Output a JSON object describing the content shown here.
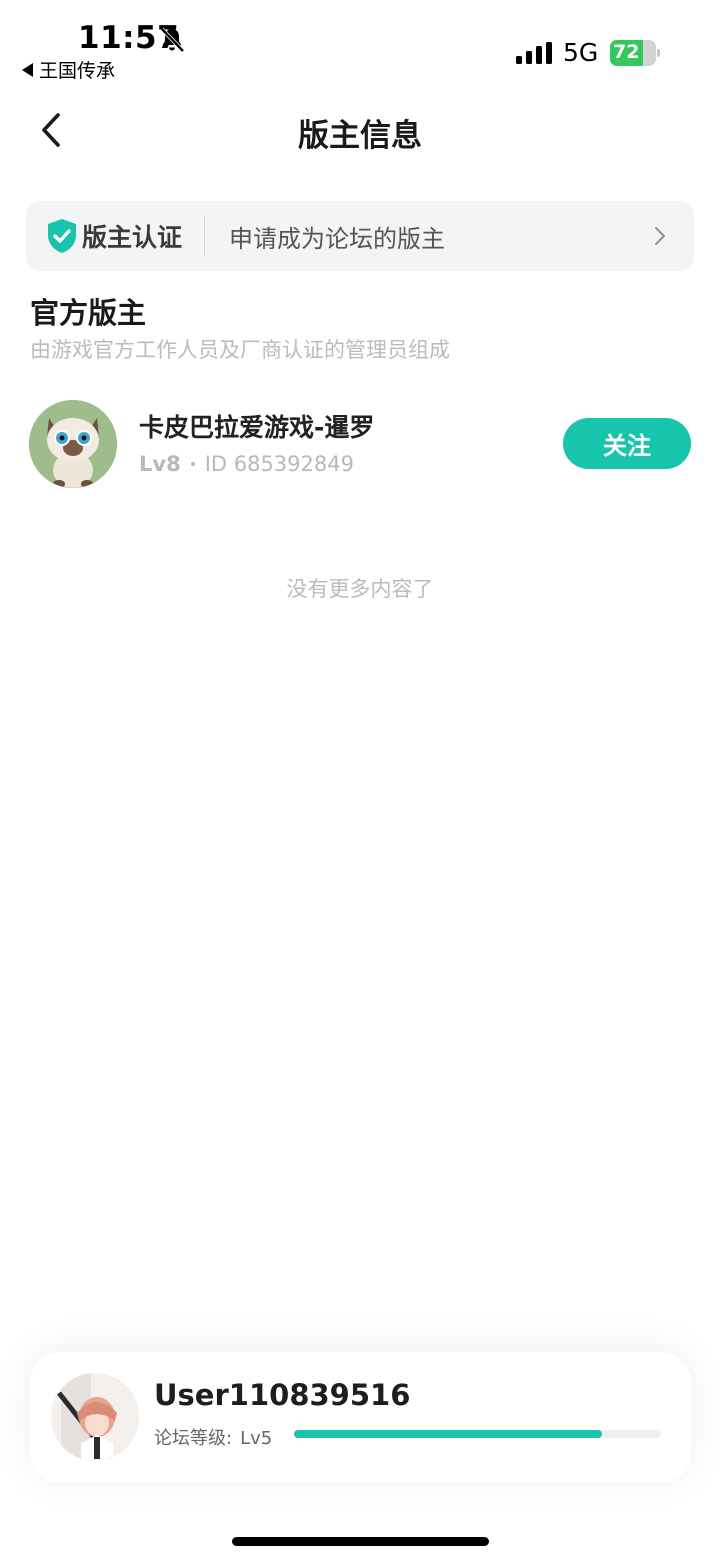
{
  "status_bar": {
    "time": "11:57",
    "back_app": "王国传承",
    "network": "5G",
    "battery_level": "72",
    "battery_fraction": 0.72,
    "battery_color": "#34c759"
  },
  "header": {
    "title": "版主信息",
    "back_icon": "chevron-left-icon"
  },
  "cert_banner": {
    "label": "版主认证",
    "description": "申请成为论坛的版主",
    "icon": "shield-check-icon",
    "accent": "#18c5ac"
  },
  "section": {
    "title": "官方版主",
    "subtitle": "由游戏官方工作人员及厂商认证的管理员组成"
  },
  "moderators": [
    {
      "name": "卡皮巴拉爱游戏-暹罗",
      "level": "Lv8",
      "id_text": "ID 685392849",
      "follow_label": "关注"
    }
  ],
  "list_end_text": "没有更多内容了",
  "user_card": {
    "username": "User110839516",
    "level_label": "论坛等级:",
    "level_value": "Lv5",
    "progress": 0.84
  }
}
